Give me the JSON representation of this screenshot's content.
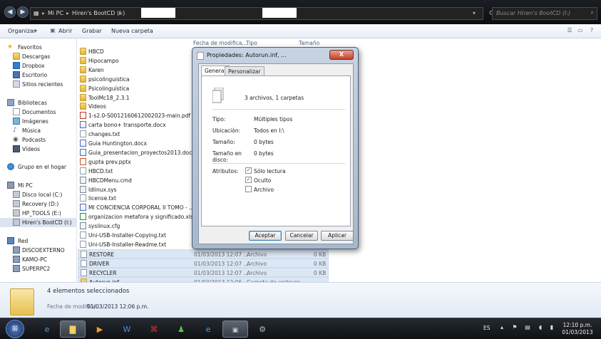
{
  "address_bar": {
    "crumbs": [
      "Mi PC",
      "Hiren's BootCD (I:)"
    ],
    "search_placeholder": "Buscar Hiren's BootCD (I:)"
  },
  "toolbar": {
    "organize": "Organizar",
    "open": "Abrir",
    "save": "Grabar",
    "new_folder": "Nueva carpeta"
  },
  "navpane": {
    "favorites": {
      "title": "Favoritos",
      "items": [
        "Descargas",
        "Dropbox",
        "Escritorio",
        "Sitios recientes"
      ]
    },
    "libraries": {
      "title": "Bibliotecas",
      "items": [
        "Documentos",
        "Imágenes",
        "Música",
        "Podcasts",
        "Vídeos"
      ]
    },
    "homegroup": "Grupo en el hogar",
    "computer": {
      "title": "Mi PC",
      "items": [
        "Disco local (C:)",
        "Recovery (D:)",
        "HP_TOOLS (E:)",
        "Hiren's BootCD (I:)"
      ]
    },
    "network": {
      "title": "Red",
      "items": [
        "DISCOEXTERNO",
        "KAMO-PC",
        "SUPERPC2"
      ]
    }
  },
  "columns": {
    "date": "Fecha de modifica...",
    "type": "Tipo",
    "size": "Tamaño"
  },
  "files": [
    {
      "name": "HBCD",
      "kind": "folder"
    },
    {
      "name": "Hipocampo",
      "kind": "folder"
    },
    {
      "name": "Karen",
      "kind": "folder"
    },
    {
      "name": "psicolinguistica",
      "kind": "folder"
    },
    {
      "name": "Psicolinguística",
      "kind": "folder"
    },
    {
      "name": "ToolMc18_2.3.1",
      "kind": "folder"
    },
    {
      "name": "Videos",
      "kind": "folder"
    },
    {
      "name": "1-s2.0-S0012160612002023-main.pdf",
      "kind": "pdf"
    },
    {
      "name": "carta bono+ transporte.docx",
      "kind": "docw"
    },
    {
      "name": "changes.txt",
      "kind": "doc"
    },
    {
      "name": "Guia Huntington.docx",
      "kind": "docw"
    },
    {
      "name": "Guia_presentacion_proyectos2013.doc",
      "kind": "docw"
    },
    {
      "name": "gupta prev.pptx",
      "kind": "ppt"
    },
    {
      "name": "HBCD.txt",
      "kind": "doc"
    },
    {
      "name": "HBCDMenu.cmd",
      "kind": "cfg"
    },
    {
      "name": "ldlinux.sys",
      "kind": "cfg"
    },
    {
      "name": "license.txt",
      "kind": "doc"
    },
    {
      "name": "MI CONCIENCIA CORPORAL II TOMO - ...",
      "kind": "docw"
    },
    {
      "name": "organizacion metafora y significado.xlsx",
      "kind": "xls"
    },
    {
      "name": "syslinux.cfg",
      "kind": "cfg"
    },
    {
      "name": "Uni-USB-Installer-Copying.txt",
      "kind": "doc"
    },
    {
      "name": "Uni-USB-Installer-Readme.txt",
      "kind": "doc"
    },
    {
      "name": "RESTORE",
      "kind": "doc",
      "selected": true,
      "date": "01/03/2013 12:07 ...",
      "type": "Archivo",
      "size": "0 KB"
    },
    {
      "name": "DRIVER",
      "kind": "doc",
      "selected": true,
      "date": "01/03/2013 12:07 ...",
      "type": "Archivo",
      "size": "0 KB"
    },
    {
      "name": "RECYCLER",
      "kind": "doc",
      "selected": true,
      "date": "01/03/2013 12:07 ...",
      "type": "Archivo",
      "size": "0 KB"
    },
    {
      "name": "Autorun.inf",
      "kind": "folder",
      "selected": true,
      "date": "01/03/2013 12:06 ...",
      "type": "Carpeta de archivos",
      "size": ""
    }
  ],
  "details": {
    "count": "4 elementos seleccionados",
    "date_label": "Fecha de modifica...",
    "date_value": "01/03/2013 12:06 p.m."
  },
  "dialog": {
    "title": "Propiedades: Autorun.inf, ...",
    "close": "X",
    "tabs": [
      "General",
      "Personalizar"
    ],
    "summary": "3 archivos, 1 carpetas",
    "rows": [
      {
        "label": "Tipo:",
        "value": "Múltiples tipos"
      },
      {
        "label": "Ubicación:",
        "value": "Todos en I:\\"
      },
      {
        "label": "Tamaño:",
        "value": "0 bytes"
      },
      {
        "label": "Tamaño en disco:",
        "value": "0 bytes"
      }
    ],
    "attributes_label": "Atributos:",
    "attributes": [
      {
        "label": "Sólo lectura",
        "checked": true
      },
      {
        "label": "Oculto",
        "checked": true
      },
      {
        "label": "Archivo",
        "checked": false
      }
    ],
    "buttons": {
      "ok": "Aceptar",
      "cancel": "Cancelar",
      "apply": "Aplicar"
    }
  },
  "taskbar": {
    "lang": "ES",
    "time": "12:10 p.m.",
    "date": "01/03/2013"
  },
  "colors": {
    "folder": "#e3b33d",
    "selection": "#dce7f5",
    "taskbar": "#0f1215"
  }
}
